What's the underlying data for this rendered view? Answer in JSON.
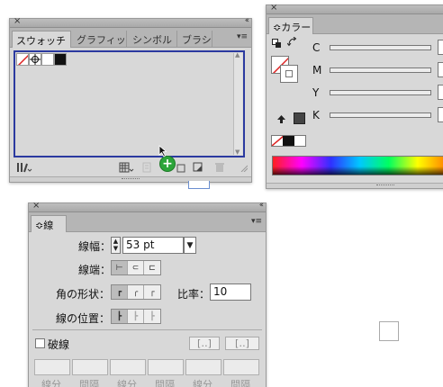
{
  "swatches_panel": {
    "close": "×",
    "collapse": "‹‹",
    "tabs": [
      "スウォッチ",
      "グラフィッ",
      "シンボル",
      "ブラシ"
    ],
    "menu": "▾≡",
    "plus_badge": "+"
  },
  "color_panel": {
    "close": "×",
    "collapse": "‹‹",
    "tab_label": "≎カラー",
    "menu": "▾≡",
    "channels": [
      "C",
      "M",
      "Y",
      "K"
    ]
  },
  "stroke_panel": {
    "close": "×",
    "collapse": "‹‹",
    "tab_label": "≎線",
    "menu": "▾≡",
    "weight_label": "線幅：",
    "weight_value": "53 pt",
    "cap_label": "線端：",
    "corner_label": "角の形状：",
    "miter_label": "比率：",
    "miter_value": "10",
    "align_label": "線の位置：",
    "dashed_label": "破線",
    "dash_labels": [
      "線分",
      "間隔",
      "線分",
      "間隔",
      "線分",
      "間隔"
    ]
  },
  "colors": {
    "accent_blue": "#2b3aa0",
    "green_badge": "#2ca53a"
  }
}
